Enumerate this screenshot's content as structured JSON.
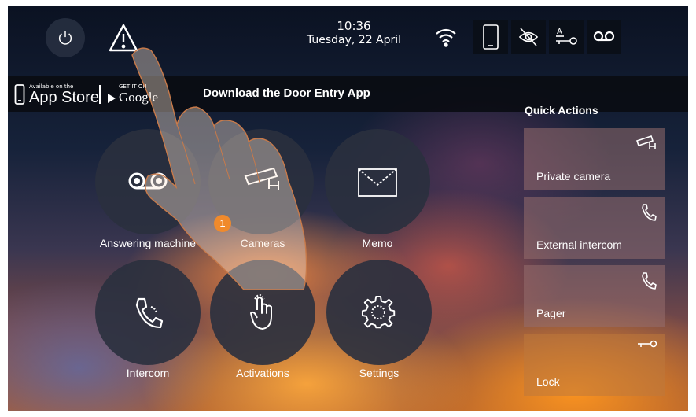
{
  "status_bar": {
    "time": "10:36",
    "date": "Tuesday, 22 April",
    "icons": [
      "power-icon",
      "warning-icon",
      "wifi-icon",
      "smartphone-icon",
      "eye-off-icon",
      "door-lock-icon",
      "answering-machine-icon"
    ]
  },
  "app_banner": {
    "appstore_small": "Available on the",
    "appstore_big": "App Store",
    "googleplay_small": "GET IT ON",
    "googleplay_big": "Google",
    "text": "Download the Door Entry App"
  },
  "main_functions": [
    {
      "label": "Answering machine",
      "icon": "answering-machine-icon"
    },
    {
      "label": "Cameras",
      "icon": "camera-icon"
    },
    {
      "label": "Memo",
      "icon": "envelope-icon"
    },
    {
      "label": "Intercom",
      "icon": "phone-icon"
    },
    {
      "label": "Activations",
      "icon": "touch-hand-icon"
    },
    {
      "label": "Settings",
      "icon": "gear-icon"
    }
  ],
  "quick_actions": {
    "title": "Quick Actions",
    "items": [
      {
        "label": "Private camera",
        "icon": "camera-icon"
      },
      {
        "label": "External intercom",
        "icon": "phone-icon"
      },
      {
        "label": "Pager",
        "icon": "phone-icon"
      },
      {
        "label": "Lock",
        "icon": "key-icon"
      }
    ]
  },
  "step_marker": "1",
  "colors": {
    "marker": "#f08a2c",
    "banner": "#0a0f18"
  }
}
